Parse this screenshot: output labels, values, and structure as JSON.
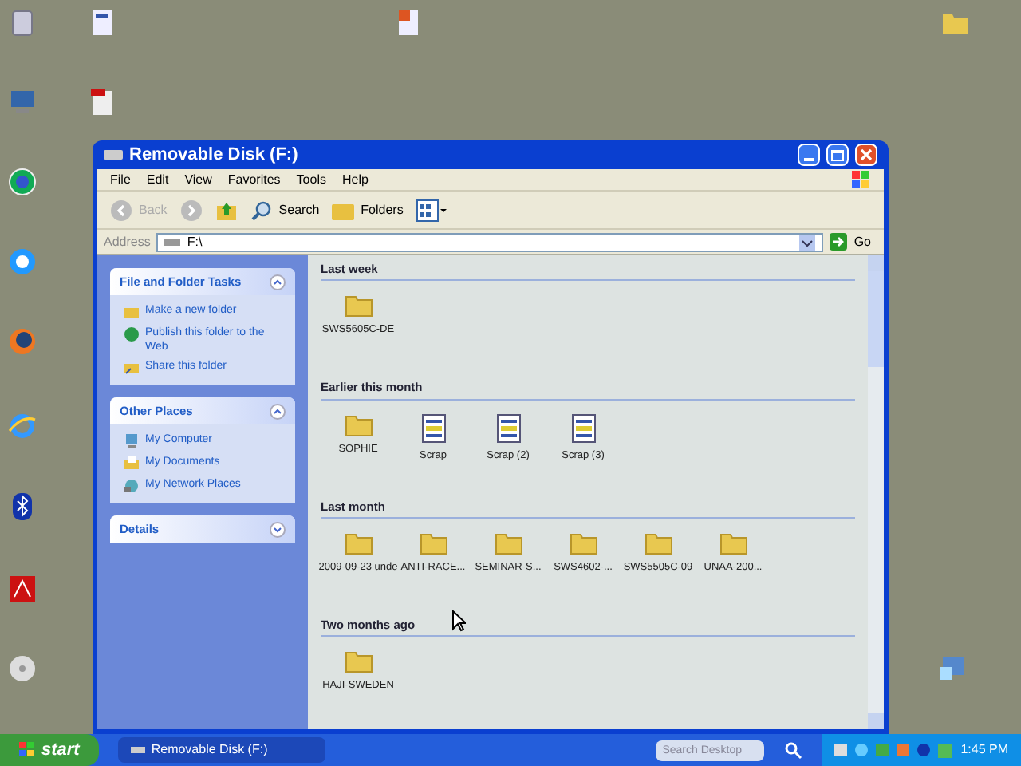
{
  "window": {
    "title": "Removable Disk (F:)"
  },
  "menu": [
    "File",
    "Edit",
    "View",
    "Favorites",
    "Tools",
    "Help"
  ],
  "toolbar": {
    "back": {
      "label": "Back",
      "disabled": true
    },
    "search": "Search",
    "folders": "Folders"
  },
  "address": {
    "label": "Address",
    "value": "F:\\",
    "go": "Go"
  },
  "task_panes": [
    {
      "title": "File and Folder Tasks",
      "expanded": true,
      "items": [
        {
          "kind": "newfolder",
          "label": "Make a new folder"
        },
        {
          "kind": "publish",
          "label": "Publish this folder to the Web"
        },
        {
          "kind": "share",
          "label": "Share this folder"
        }
      ]
    },
    {
      "title": "Other Places",
      "expanded": true,
      "items": [
        {
          "kind": "computer",
          "label": "My Computer"
        },
        {
          "kind": "documents",
          "label": "My Documents"
        },
        {
          "kind": "network",
          "label": "My Network Places"
        }
      ]
    },
    {
      "title": "Details",
      "expanded": false
    }
  ],
  "groups": [
    {
      "heading": "Last week",
      "files": [
        {
          "kind": "folder",
          "name": "SWS5605C-DE"
        }
      ]
    },
    {
      "heading": "Earlier this month",
      "files": [
        {
          "kind": "folder",
          "name": "SOPHIE"
        },
        {
          "kind": "scrap",
          "name": "Scrap"
        },
        {
          "kind": "scrap",
          "name": "Scrap (2)"
        },
        {
          "kind": "scrap",
          "name": "Scrap (3)"
        }
      ]
    },
    {
      "heading": "Last month",
      "files": [
        {
          "kind": "folder",
          "name": "2009-09-23 unde"
        },
        {
          "kind": "folder",
          "name": "ANTI-RACE..."
        },
        {
          "kind": "folder",
          "name": "SEMINAR-S..."
        },
        {
          "kind": "folder",
          "name": "SWS4602-..."
        },
        {
          "kind": "folder",
          "name": "SWS5505C-09"
        },
        {
          "kind": "folder",
          "name": "UNAA-200..."
        }
      ]
    },
    {
      "heading": "Two months ago",
      "files": [
        {
          "kind": "folder",
          "name": "HAJI-SWEDEN"
        }
      ]
    }
  ],
  "taskbar": {
    "start": "start",
    "task": "Removable Disk (F:)",
    "search_placeholder": "Search Desktop",
    "clock": "1:45 PM"
  }
}
